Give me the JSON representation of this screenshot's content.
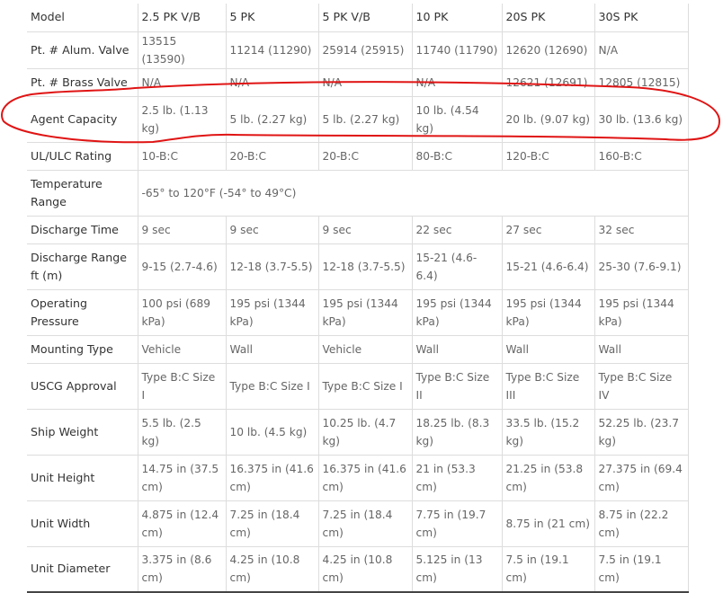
{
  "table": {
    "header": {
      "label": "Model",
      "values": [
        "2.5 PK V/B",
        "5 PK",
        "5 PK V/B",
        "10 PK",
        "20S PK",
        "30S PK"
      ]
    },
    "rows": [
      {
        "label": "Pt. # Alum. Valve",
        "values": [
          "13515 (13590)",
          "11214 (11290)",
          "25914 (25915)",
          "11740 (11790)",
          "12620 (12690)",
          "N/A"
        ]
      },
      {
        "label": "Pt. # Brass Valve",
        "values": [
          "N/A",
          "N/A",
          "N/A",
          "N/A",
          "12621 (12691)",
          "12805 (12815)"
        ]
      },
      {
        "label": "Agent Capacity",
        "values": [
          "2.5 lb. (1.13 kg)",
          "5 lb. (2.27 kg)",
          "5 lb. (2.27 kg)",
          "10 lb. (4.54 kg)",
          "20 lb. (9.07 kg)",
          "30 lb. (13.6 kg)"
        ]
      },
      {
        "label": "UL/ULC Rating",
        "values": [
          "10-B:C",
          "20-B:C",
          "20-B:C",
          "80-B:C",
          "120-B:C",
          "160-B:C"
        ]
      },
      {
        "label": "Temperature Range",
        "merged": "-65° to 120°F (-54° to 49°C)"
      },
      {
        "label": "Discharge Time",
        "values": [
          "9 sec",
          "9 sec",
          "9 sec",
          "22 sec",
          "27 sec",
          "32 sec"
        ]
      },
      {
        "label": "Discharge Range ft (m)",
        "values": [
          "9-15 (2.7-4.6)",
          "12-18 (3.7-5.5)",
          "12-18 (3.7-5.5)",
          "15-21 (4.6-6.4)",
          "15-21 (4.6-6.4)",
          "25-30 (7.6-9.1)"
        ]
      },
      {
        "label": "Operating Pressure",
        "values": [
          "100 psi (689 kPa)",
          "195 psi (1344 kPa)",
          "195 psi (1344 kPa)",
          "195 psi (1344 kPa)",
          "195 psi (1344 kPa)",
          "195 psi (1344 kPa)"
        ]
      },
      {
        "label": "Mounting Type",
        "values": [
          "Vehicle",
          "Wall",
          "Vehicle",
          "Wall",
          "Wall",
          "Wall"
        ]
      },
      {
        "label": "USCG Approval",
        "values": [
          "Type B:C Size I",
          "Type B:C Size I",
          "Type B:C Size I",
          "Type B:C Size II",
          "Type B:C Size III",
          "Type B:C Size IV"
        ]
      },
      {
        "label": "Ship Weight",
        "values": [
          "5.5 lb. (2.5 kg)",
          "10 lb. (4.5 kg)",
          "10.25 lb. (4.7 kg)",
          "18.25 lb. (8.3 kg)",
          "33.5 lb. (15.2 kg)",
          "52.25 lb. (23.7 kg)"
        ]
      },
      {
        "label": "Unit Height",
        "values": [
          "14.75 in (37.5 cm)",
          "16.375 in (41.6 cm)",
          "16.375 in (41.6 cm)",
          "21 in (53.3 cm)",
          "21.25 in (53.8 cm)",
          "27.375 in (69.4 cm)"
        ]
      },
      {
        "label": "Unit Width",
        "values": [
          "4.875 in (12.4 cm)",
          "7.25 in (18.4 cm)",
          "7.25 in (18.4 cm)",
          "7.75 in (19.7 cm)",
          "8.75 in (21 cm)",
          "8.75 in (22.2 cm)"
        ]
      },
      {
        "label": "Unit Diameter",
        "values": [
          "3.375 in (8.6 cm)",
          "4.25 in (10.8 cm)",
          "4.25 in (10.8 cm)",
          "5.125 in (13 cm)",
          "7.5 in (19.1 cm)",
          "7.5 in (19.1 cm)"
        ]
      }
    ]
  },
  "annotation": {
    "color": "#e01414",
    "highlighted_row": "Agent Capacity"
  }
}
